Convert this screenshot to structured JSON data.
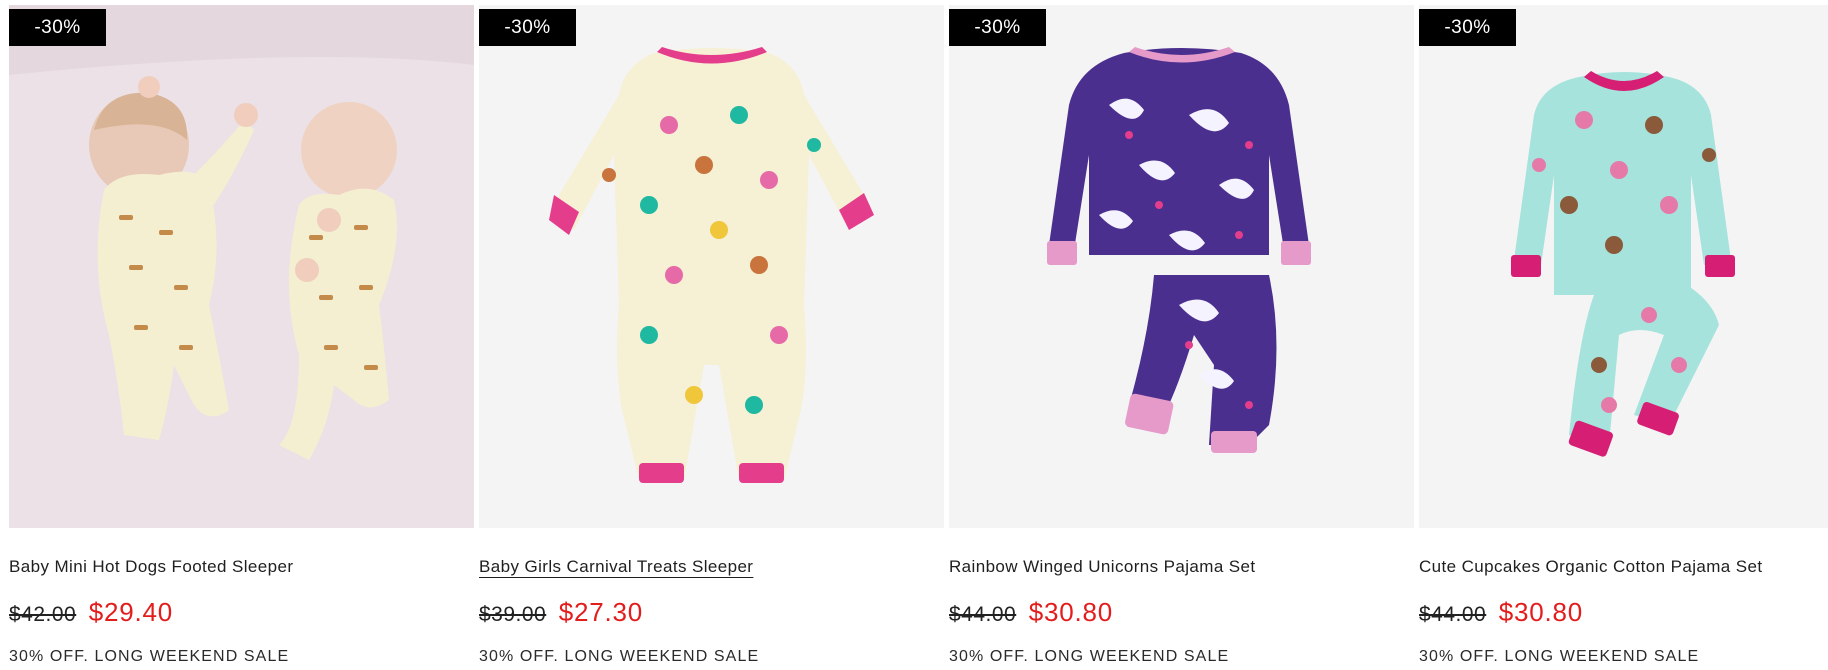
{
  "products": [
    {
      "discount_badge": "-30%",
      "title": "Baby Mini Hot Dogs Footed Sleeper",
      "old_price": "$42.00",
      "new_price": "$29.40",
      "promo": "30% OFF. LONG WEEKEND SALE"
    },
    {
      "discount_badge": "-30%",
      "title": "Baby Girls Carnival Treats Sleeper",
      "old_price": "$39.00",
      "new_price": "$27.30",
      "promo": "30% OFF. LONG WEEKEND SALE"
    },
    {
      "discount_badge": "-30%",
      "title": "Rainbow Winged Unicorns Pajama Set",
      "old_price": "$44.00",
      "new_price": "$30.80",
      "promo": "30% OFF. LONG WEEKEND SALE"
    },
    {
      "discount_badge": "-30%",
      "title": "Cute Cupcakes Organic Cotton Pajama Set",
      "old_price": "$44.00",
      "new_price": "$30.80",
      "promo": "30% OFF. LONG WEEKEND SALE"
    }
  ],
  "colors": {
    "badge_bg": "#000000",
    "sale_price": "#e31c1c",
    "image_bg": "#f4f4f4"
  }
}
